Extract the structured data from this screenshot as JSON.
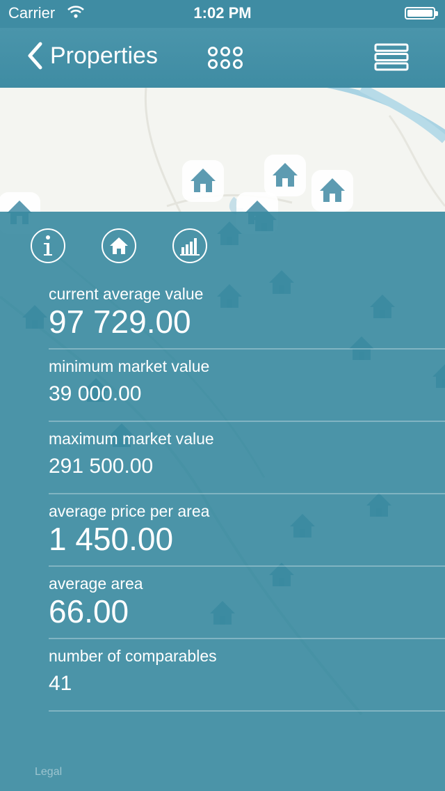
{
  "status_bar": {
    "carrier": "Carrier",
    "time": "1:02 PM"
  },
  "nav": {
    "back_label": "Properties"
  },
  "stats": [
    {
      "label": "current average value",
      "value": "97 729.00"
    },
    {
      "label": "minimum market value",
      "value": "39 000.00"
    },
    {
      "label": "maximum market value",
      "value": "291 500.00"
    },
    {
      "label": "average price per area",
      "value": "1 450.00"
    },
    {
      "label": "average area",
      "value": "66.00"
    },
    {
      "label": "number of comparables",
      "value": "41"
    }
  ],
  "map": {
    "legal_label": "Legal"
  },
  "colors": {
    "accent": "#3f8ca3",
    "overlay": "#388aa0",
    "map_bg": "#f4f5f1"
  },
  "icons": [
    "wifi-icon",
    "battery-icon",
    "back-chevron-icon",
    "grid-icon",
    "menu-icon",
    "info-icon",
    "home-icon",
    "bar-chart-icon",
    "house-marker-icon"
  ]
}
